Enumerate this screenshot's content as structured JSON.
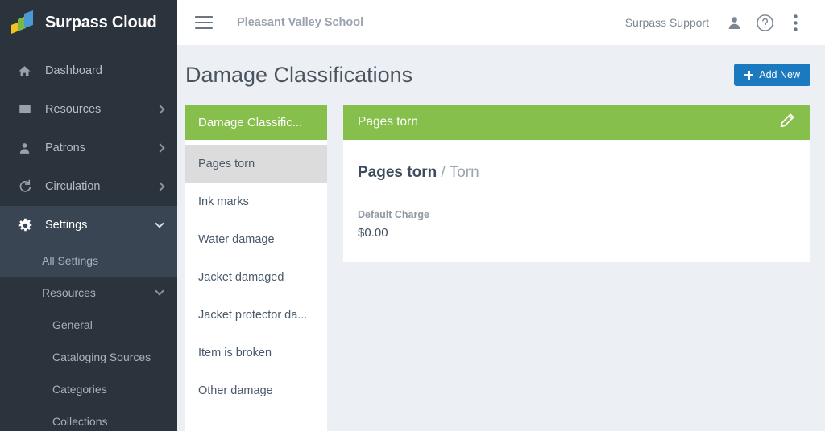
{
  "brand": {
    "name": "Surpass Cloud",
    "logo_icon": "surpass-books-logo",
    "colors": {
      "yellow": "#f0c323",
      "green": "#7db648",
      "blue": "#4c9ad4"
    }
  },
  "sidebar": {
    "background": "#2b333d",
    "items": [
      {
        "label": "Dashboard",
        "icon": "home-icon",
        "expandable": false,
        "active": false
      },
      {
        "label": "Resources",
        "icon": "book-icon",
        "expandable": true,
        "active": false
      },
      {
        "label": "Patrons",
        "icon": "person-icon",
        "expandable": true,
        "active": false
      },
      {
        "label": "Circulation",
        "icon": "refresh-icon",
        "expandable": true,
        "active": false
      },
      {
        "label": "Settings",
        "icon": "gear-icon",
        "expandable": true,
        "active": true
      }
    ],
    "settings_children": [
      {
        "label": "All Settings",
        "level": 1,
        "expandable": false,
        "highlight": true
      },
      {
        "label": "Resources",
        "level": 1,
        "expandable": true,
        "highlight": false
      },
      {
        "label": "General",
        "level": 2,
        "expandable": false,
        "highlight": false
      },
      {
        "label": "Cataloging Sources",
        "level": 2,
        "expandable": false,
        "highlight": false
      },
      {
        "label": "Categories",
        "level": 2,
        "expandable": false,
        "highlight": false
      },
      {
        "label": "Collections",
        "level": 2,
        "expandable": false,
        "highlight": false
      }
    ]
  },
  "topbar": {
    "menu_icon": "hamburger-icon",
    "school_name": "Pleasant Valley School",
    "user_name": "Surpass Support",
    "user_icon": "person-icon",
    "help_icon": "help-circle-icon",
    "overflow_icon": "more-vertical-icon"
  },
  "page": {
    "title": "Damage Classifications",
    "add_new_label": "Add New",
    "add_new_color": "#1b79bf"
  },
  "list_panel": {
    "header": "Damage Classific...",
    "header_color": "#86bf4b",
    "items": [
      {
        "label": "Pages torn",
        "selected": true
      },
      {
        "label": "Ink marks",
        "selected": false
      },
      {
        "label": "Water damage",
        "selected": false
      },
      {
        "label": "Jacket damaged",
        "selected": false
      },
      {
        "label": "Jacket protector da...",
        "selected": false
      },
      {
        "label": "Item is broken",
        "selected": false
      },
      {
        "label": "Other damage",
        "selected": false
      }
    ]
  },
  "detail_panel": {
    "header": "Pages torn",
    "header_color": "#86bf4b",
    "edit_icon": "pencil-icon",
    "name": "Pages torn",
    "separator": " / ",
    "subtype": "Torn",
    "field_label": "Default Charge",
    "field_value": "$0.00"
  }
}
